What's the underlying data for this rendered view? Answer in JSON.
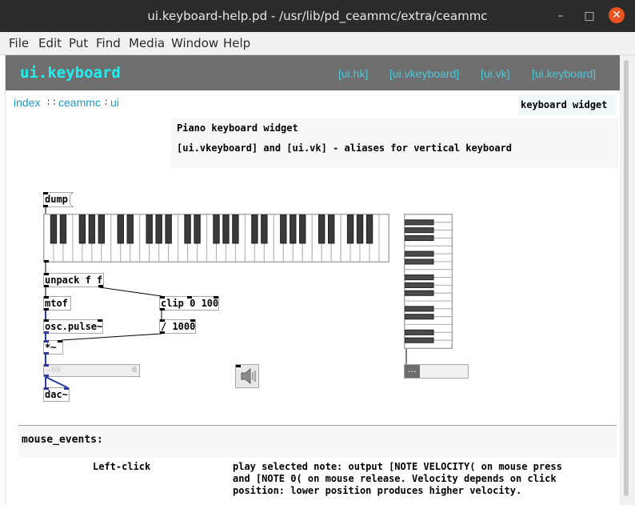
{
  "window": {
    "title": "ui.keyboard-help.pd  - /usr/lib/pd_ceammc/extra/ceammc",
    "minimize_glyph": "–",
    "maximize_glyph": "□",
    "close_glyph": "✕"
  },
  "menubar": {
    "items": [
      {
        "key": "F",
        "rest": "ile"
      },
      {
        "key": "E",
        "rest": "dit"
      },
      {
        "key": "P",
        "rest": "ut"
      },
      {
        "key": "F",
        "rest": "ind",
        "hotkey_index": 3
      },
      {
        "key": "M",
        "rest": "edia"
      },
      {
        "key": "W",
        "rest": "indow"
      },
      {
        "key": "H",
        "rest": "elp"
      }
    ],
    "labels": [
      "File",
      "Edit",
      "Put",
      "Find",
      "Media",
      "Window",
      "Help"
    ]
  },
  "header": {
    "name": "ui.keyboard",
    "links": [
      "[ui.hk]",
      "[ui.vkeyboard]",
      "[ui.vk]",
      "[ui.keyboard]"
    ]
  },
  "breadcrumb": {
    "items": [
      "index",
      "ceammc",
      "ui"
    ],
    "separators": [
      "::",
      ":"
    ]
  },
  "keywords": "keyboard widget",
  "description": {
    "line1": "Piano keyboard widget",
    "line2": "[ui.vkeyboard] and [ui.vk] - aliases for vertical keyboard"
  },
  "patch": {
    "dump": "dump",
    "unpack": "unpack f f",
    "mtof": "mtof",
    "clip": "clip 0 100",
    "osc": "osc.pulse~",
    "div": "/ 1000",
    "mul": "*~",
    "dac": "dac~",
    "gain_label": "-60",
    "gain_value": "0",
    "vslider_label": "...",
    "keyboard_white_keys": 36,
    "vkeyboard_white_keys": 17
  },
  "sections": {
    "mouse_events": "mouse_events:",
    "left_click": "Left-click",
    "left_click_desc": [
      "play selected note: output [NOTE VELOCITY( on mouse press",
      "and [NOTE 0( on mouse release. Velocity depends on click",
      "position: lower position produces higher velocity."
    ]
  },
  "colors": {
    "titlebar": "#2b2b2b",
    "header_bg": "#6f6f6f",
    "header_name": "#1ff0f0",
    "header_link": "#4fc6d6",
    "breadcrumb": "#1c9bc5",
    "close_button": "#e95420",
    "signal_outlet": "#2a3a9e"
  }
}
